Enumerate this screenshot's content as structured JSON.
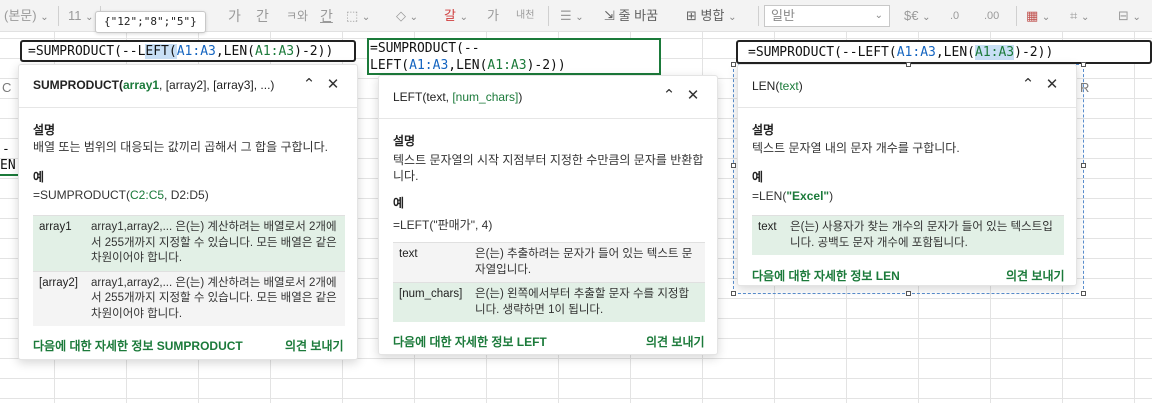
{
  "toolbar": {
    "font_name": "(본문)",
    "font_size": "11",
    "number_format": "일반",
    "wrap_label": "줄 바꿈",
    "merge_label": "병합",
    "currency_label": "$€",
    "wrap_icon": "wrap-text-icon",
    "merge_icon": "merge-cells-icon"
  },
  "hint": {
    "value": "{\"12\";\"8\";\"5\"}"
  },
  "formulas": {
    "left": {
      "p1": "=SUMPRODUCT(--L",
      "cursor": "EFT(",
      "r1": "A1:A3",
      "p2": ",LEN(",
      "r2": "A1:A3",
      "p3": ")-2))"
    },
    "middle": {
      "line1": "=SUMPRODUCT(--",
      "l2a": "LEFT(",
      "r1": "A1:A3",
      "l2b": ",LEN(",
      "r2": "A1:A3",
      "l2c": ")-2))"
    },
    "right": {
      "p1": "=SUMPRODUCT(--LEFT(",
      "r1": "A1:A3",
      "p2": ",LEN(",
      "r2": "A1:A3",
      "p3": ")-2))"
    }
  },
  "grid": {
    "col_c": "C",
    "col_r": "R",
    "frag1": "-",
    "frag2": "EN("
  },
  "cards": {
    "sumproduct": {
      "fn": "SUMPRODUCT(",
      "arg_active": "array1",
      "args_rest": ", [array2], [array3], ...)",
      "desc_title": "설명",
      "desc": "배열 또는 범위의 대응되는 값끼리 곱해서 그 합을 구합니다.",
      "example_title": "예",
      "example_pre": "=SUMPRODUCT(",
      "example_range": "C2:C5",
      "example_post": ", D2:D5)",
      "rows": [
        {
          "name": "array1",
          "text": "array1,array2,... 은(는) 계산하려는 배열로서 2개에서 255개까지 지정할 수 있습니다. 모든 배열은 같은 차원이어야 합니다."
        },
        {
          "name": "[array2]",
          "text": "array1,array2,... 은(는) 계산하려는 배열로서 2개에서 255개까지 지정할 수 있습니다. 모든 배열은 같은 차원이어야 합니다."
        }
      ],
      "more": "다음에 대한 자세한 정보 SUMPRODUCT",
      "feedback": "의견 보내기"
    },
    "left": {
      "fn": "LEFT(text, ",
      "arg_active": "[num_chars]",
      "args_rest": ")",
      "desc_title": "설명",
      "desc": "텍스트 문자열의 시작 지점부터 지정한 수만큼의 문자를 반환합니다.",
      "example_title": "예",
      "example": "=LEFT(\"판매가\", 4)",
      "rows": [
        {
          "name": "text",
          "text": "은(는) 추출하려는 문자가 들어 있는 텍스트 문자열입니다."
        },
        {
          "name": "[num_chars]",
          "text": "은(는) 왼쪽에서부터 추출할 문자 수를 지정합니다. 생략하면 1이 됩니다."
        }
      ],
      "more": "다음에 대한 자세한 정보 LEFT",
      "feedback": "의견 보내기"
    },
    "len": {
      "fn": "LEN(",
      "arg_active": "text",
      "args_rest": ")",
      "desc_title": "설명",
      "desc": "텍스트 문자열 내의 문자 개수를 구합니다.",
      "example_title": "예",
      "example_pre": "=LEN(",
      "example_arg": "\"Excel\"",
      "example_post": ")",
      "rows": [
        {
          "name": "text",
          "text": "은(는) 사용자가 찾는 개수의 문자가 들어 있는 텍스트입니다. 공백도 문자 개수에 포함됩니다."
        }
      ],
      "more": "다음에 대한 자세한 정보 LEN",
      "feedback": "의견 보내기"
    }
  },
  "icons": {
    "collapse": "chevron-up-icon",
    "close": "close-icon"
  }
}
